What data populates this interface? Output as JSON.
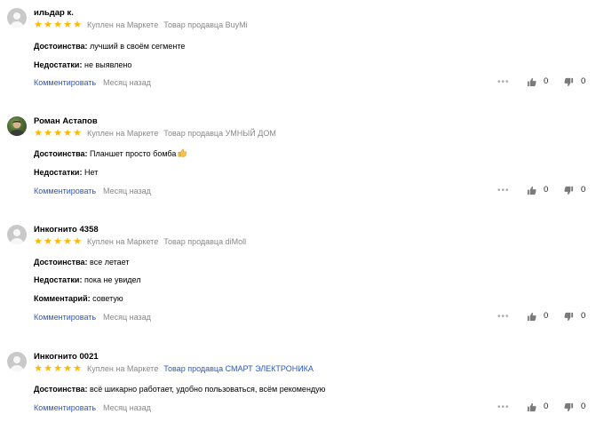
{
  "colors": {
    "star": "#ffb700",
    "link": "#2b57c9",
    "muted": "#888888"
  },
  "reviews": [
    {
      "author": "ильдар к.",
      "stars": 5,
      "bought": "Куплен на Маркете",
      "seller": "Товар продавца BuyMi",
      "pros_label": "Достоинства:",
      "pros": "лучший в своём сегменте",
      "cons_label": "Недостатки:",
      "cons": "не выявлено",
      "comment_label": "Комментировать",
      "time": "Месяц назад",
      "likes": "0",
      "dislikes": "0"
    },
    {
      "author": "Роман Астапов",
      "stars": 5,
      "bought": "Куплен на Маркете",
      "seller": "Товар продавца УМНЫЙ ДОМ",
      "pros_label": "Достоинства:",
      "pros": "Планшет просто бомба",
      "cons_label": "Недостатки:",
      "cons": "Нет",
      "comment_label": "Комментировать",
      "time": "Месяц назад",
      "likes": "0",
      "dislikes": "0"
    },
    {
      "author": "Инкогнито 4358",
      "stars": 5,
      "bought": "Куплен на Маркете",
      "seller": "Товар продавца diMoll",
      "pros_label": "Достоинства:",
      "pros": "все летает",
      "cons_label": "Недостатки:",
      "cons": "пока не увидел",
      "extra_label": "Комментарий:",
      "extra": "советую",
      "comment_label": "Комментировать",
      "time": "Месяц назад",
      "likes": "0",
      "dislikes": "0"
    },
    {
      "author": "Инкогнито 0021",
      "stars": 5,
      "bought": "Куплен на Маркете",
      "seller": "Товар продавца СМАРТ ЭЛЕКТРОНИКА",
      "pros_label": "Достоинства:",
      "pros": "всё шикарно работает, удобно пользоваться, всём рекомендую",
      "comment_label": "Комментировать",
      "time": "Месяц назад",
      "likes": "0",
      "dislikes": "0"
    }
  ]
}
